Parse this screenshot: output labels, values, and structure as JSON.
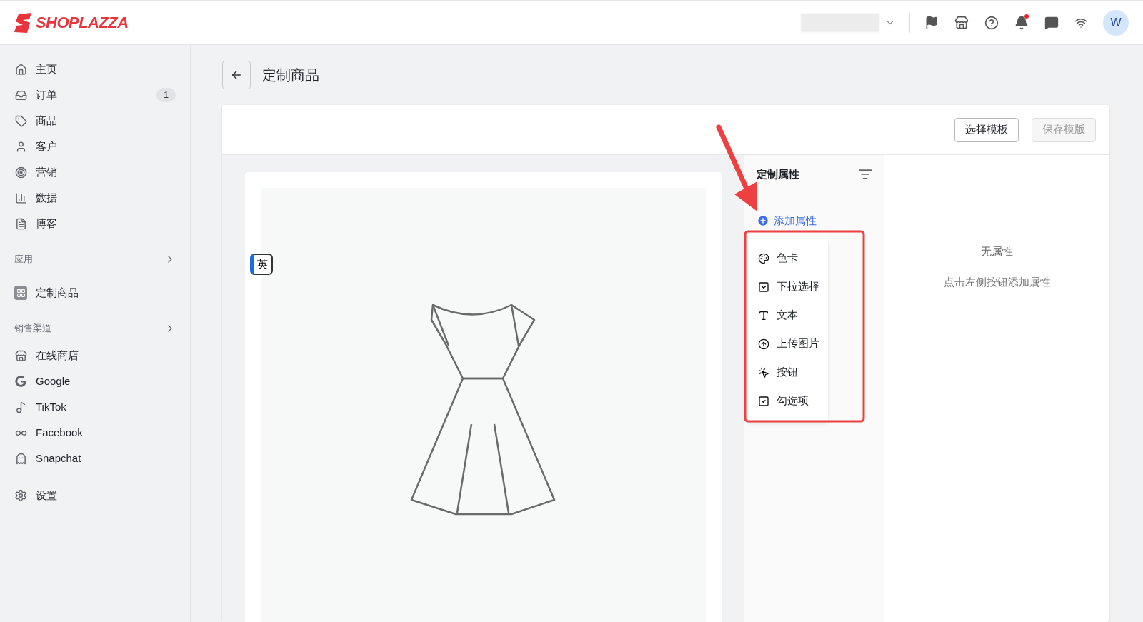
{
  "header": {
    "logo": "SHOPLAZZA",
    "avatar": "W",
    "notification_dot": true
  },
  "sidebar": {
    "main_items": [
      {
        "label": "主页"
      },
      {
        "label": "订单",
        "badge": "1"
      },
      {
        "label": "商品"
      },
      {
        "label": "客户"
      },
      {
        "label": "营销"
      },
      {
        "label": "数据"
      },
      {
        "label": "博客"
      }
    ],
    "apps_section": {
      "title": "应用",
      "items": [
        {
          "label": "定制商品"
        }
      ]
    },
    "channels_section": {
      "title": "销售渠道",
      "items": [
        {
          "label": "在线商店"
        },
        {
          "label": "Google"
        },
        {
          "label": "TikTok"
        },
        {
          "label": "Facebook"
        },
        {
          "label": "Snapchat"
        }
      ]
    },
    "settings": {
      "label": "设置"
    }
  },
  "page": {
    "title": "定制商品",
    "buttons": [
      {
        "label": "选择模板",
        "disabled": false
      },
      {
        "label": "保存模版",
        "disabled": true
      }
    ],
    "language_tag": "英",
    "attributes_panel": {
      "title": "定制属性",
      "add_button": "添加属性",
      "menu_items": [
        {
          "label": "色卡"
        },
        {
          "label": "下拉选择"
        },
        {
          "label": "文本"
        },
        {
          "label": "上传图片"
        },
        {
          "label": "按钮"
        },
        {
          "label": "勾选项"
        }
      ]
    },
    "empty_state": {
      "title": "无属性",
      "hint": "点击左侧按钮添加属性"
    }
  }
}
